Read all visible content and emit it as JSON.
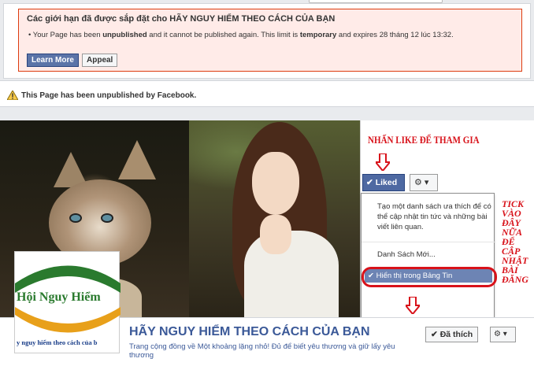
{
  "limits": {
    "title": "Các giới hạn đã được sắp đặt cho HÃY NGUY HIỂM THEO CÁCH CỦA BẠN",
    "msg_part1": "Your Page has been ",
    "msg_bold1": "unpublished",
    "msg_part2": " and it cannot be published again. This limit is ",
    "msg_bold2": "temporary",
    "msg_part3": " and expires 28 tháng 12 lúc 13:32.",
    "learn_more": "Learn More",
    "appeal": "Appeal",
    "colors": {
      "box_bg": "#ffebe8",
      "box_border": "#dd3c10",
      "primary": "#5b74a8"
    }
  },
  "notice": {
    "icon": "warning-icon",
    "text": "This Page has been unpublished by Facebook."
  },
  "cover": {
    "like_callout": "NHẤN LIKE ĐỂ THAM GIA",
    "liked_button": "✔ Liked",
    "gear_button": "⚙ ▾",
    "menu_item1": "Tạo một danh sách ưa thích để có thể cập nhật tin tức và những bài viết liên quan.",
    "menu_item2": "Danh Sách Mới...",
    "menu_item3": "✔ Hiển thị trong Bảng Tin",
    "tick_callout": "TICK VÀO ĐÂY NỮA ĐỂ CẬP NHẬT BÀI ĐĂNG",
    "accent": "#d8121a"
  },
  "logo": {
    "top_text": "Hội Nguy Hiểm",
    "bottom_text": "y nguy hiểm theo cách của b"
  },
  "page": {
    "name": "HÃY NGUY HIỂM THEO CÁCH CỦA BẠN",
    "description": "Trang cộng đồng về Một khoảng lặng nhỏ! Đủ để biết yêu thương và giữ lấy yêu thương",
    "liked_button": "✔ Đã thích",
    "gear_button": "⚙ ▾"
  }
}
